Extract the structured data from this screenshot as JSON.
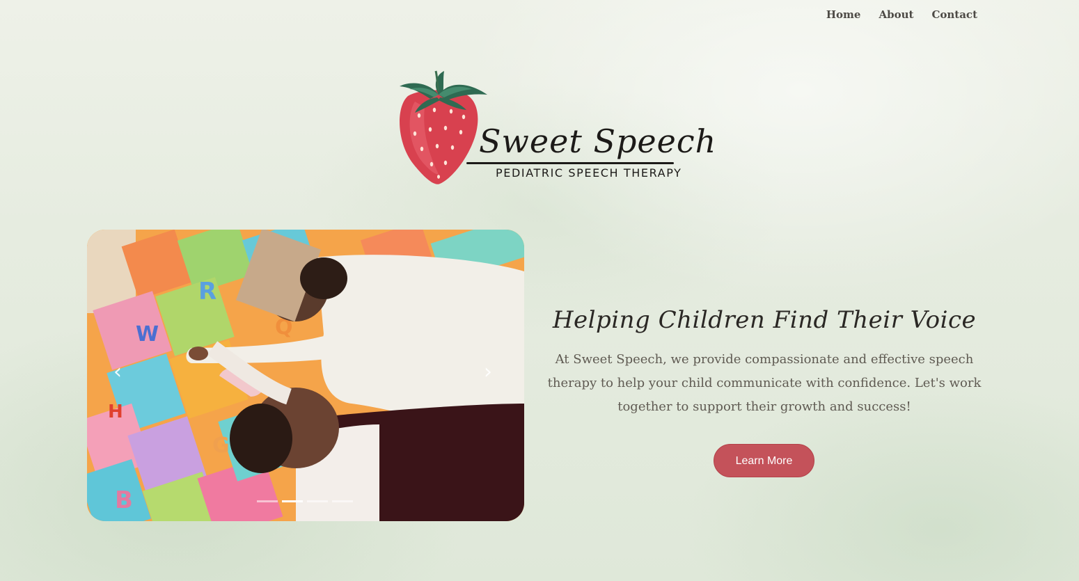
{
  "nav": {
    "items": [
      {
        "label": "Home"
      },
      {
        "label": "About"
      },
      {
        "label": "Contact"
      }
    ]
  },
  "logo": {
    "title": "Sweet Speech",
    "subtitle": "PEDIATRIC SPEECH THERAPY",
    "icon": "strawberry-icon"
  },
  "carousel": {
    "prev_icon": "‹",
    "next_icon": "›",
    "slide_count": 4,
    "active_slide": 2
  },
  "hero": {
    "heading": "Helping Children Find Their Voice",
    "body": "At Sweet Speech, we provide compassionate and effective speech therapy to help your child communicate with confidence. Let's work together to support their growth and success!",
    "button_label": "Learn More"
  },
  "colors": {
    "accent": "#c4525a",
    "nav_text": "#4d4a45",
    "body_text": "#5f5a52",
    "heading_text": "#2a2724"
  }
}
